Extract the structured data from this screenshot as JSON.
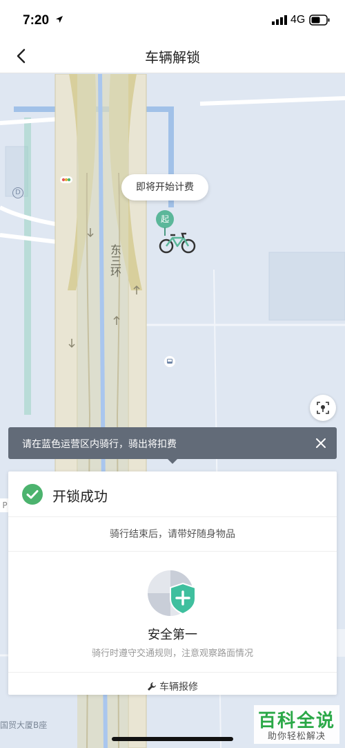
{
  "status_bar": {
    "time": "7:20",
    "network": "4G"
  },
  "nav": {
    "title": "车辆解锁"
  },
  "map": {
    "bubble_text": "即将开始计费",
    "start_marker": "起",
    "road_name": "东三环",
    "place_label": "国贸大厦B座",
    "parking_tag": "P"
  },
  "banner": {
    "text": "请在蓝色运营区内骑行，骑出将扣费"
  },
  "card": {
    "title": "开锁成功",
    "subtitle": "骑行结束后，请带好随身物品",
    "safety_title": "安全第一",
    "safety_desc": "骑行时遵守交通规则，注意观察路面情况",
    "repair_label": "车辆报修"
  },
  "watermark": {
    "title": "百科全说",
    "subtitle": "助你轻松解决"
  },
  "colors": {
    "accent_green": "#4cb36e",
    "banner_bg": "#626b78",
    "zone_blue": "#6ea3e0"
  }
}
